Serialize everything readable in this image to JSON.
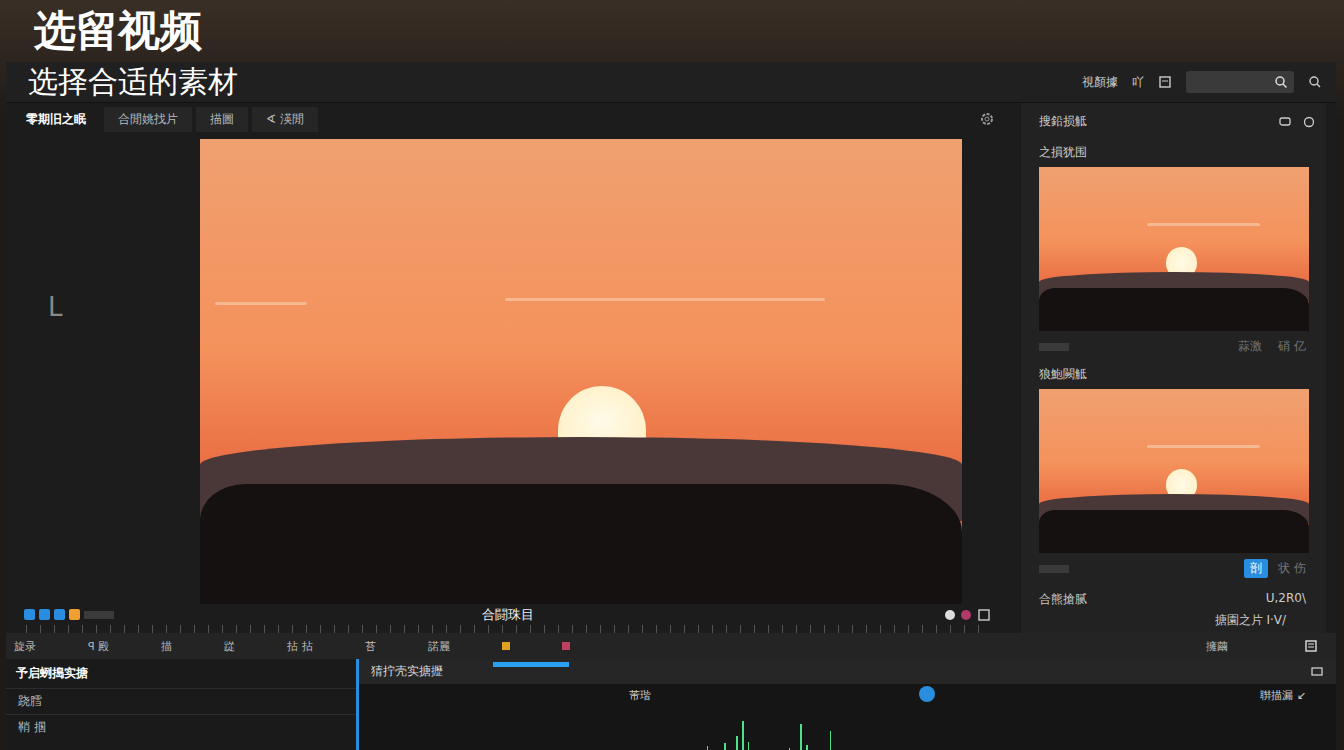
{
  "header": {
    "title": "选留视频",
    "subtitle": "选择合适的素材"
  },
  "toolbar": {
    "label": "視顏據",
    "glyph": "吖",
    "search": {
      "placeholder": ""
    }
  },
  "tabs": [
    {
      "label": "零期旧之眠",
      "selected": true
    },
    {
      "label": "合閒姚找片",
      "selected": false
    },
    {
      "label": "描圖",
      "selected": false
    },
    {
      "label": "∢ 渶閒",
      "selected": false
    }
  ],
  "preview": {
    "corner_glyph": "L",
    "caption": "合闘珠目"
  },
  "side_panel": {
    "title": "搜鉛损觝",
    "items": [
      {
        "label": "之損犹围",
        "action": "蒜激",
        "extra": "硝 亿",
        "selected": false
      },
      {
        "label": "狼鮑闕觝",
        "action": "剖",
        "extra": "状 伤",
        "selected": true
      }
    ],
    "footer_left": "合熊搶腻",
    "footer_right": "U,2R0\\"
  },
  "side_caption": "搪園之片 I·V/",
  "controls": {
    "items": [
      "旋录",
      "ꟼ 殿",
      "描",
      "踨",
      "拈 拈",
      "苔",
      "諾麗"
    ],
    "right": "擁繭"
  },
  "track_panel": {
    "title": "予启蛚搗实搪",
    "items": [
      "跷膤",
      "鞘 掴"
    ]
  },
  "timeline": {
    "title": "猜拧壳实搪攊",
    "ruler": "芾瑎",
    "right_label": "聨描漏 ↙",
    "waveform": [
      0,
      0,
      0,
      8,
      0,
      0,
      14,
      0,
      30,
      62,
      18,
      0,
      0,
      0,
      0,
      0,
      0,
      4,
      0,
      55,
      10,
      0,
      0,
      0,
      40,
      0,
      0,
      0
    ]
  }
}
